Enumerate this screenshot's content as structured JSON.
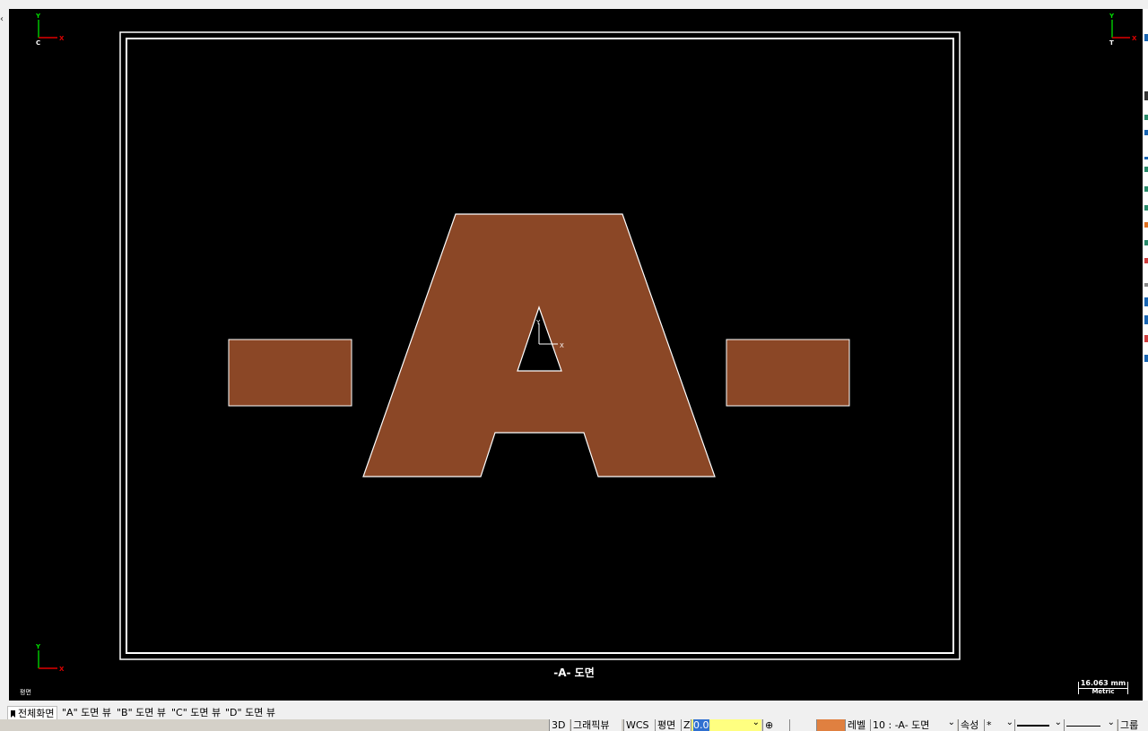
{
  "viewport": {
    "axis_x": "X",
    "axis_y": "Y",
    "corner_top_left_letter": "C",
    "corner_top_right_letter": "T",
    "sheet_title": "-A- 도면",
    "view_label": "평면",
    "scale_value": "16.063 mm",
    "scale_unit": "Metric",
    "fill_color": "#8B4726",
    "outline_color": "#ffffff",
    "background_color": "#000000"
  },
  "tabs": [
    {
      "label": "전체화면",
      "active": true
    },
    {
      "label": "\"A\" 도면 뷰",
      "active": false
    },
    {
      "label": "\"B\" 도면 뷰",
      "active": false
    },
    {
      "label": "\"C\" 도면 뷰",
      "active": false
    },
    {
      "label": "\"D\" 도면 뷰",
      "active": false
    }
  ],
  "status_bar": {
    "mode_3d": "3D",
    "graphics": "그래픽뷰",
    "wcs": "WCS",
    "plane": "평면",
    "z_label": "Z",
    "z_value": "0.0",
    "level_label": "레벨",
    "level_value": "10 : -A- 도면",
    "attribute_label": "속성",
    "attribute_value": "*",
    "group_label": "그룹"
  }
}
